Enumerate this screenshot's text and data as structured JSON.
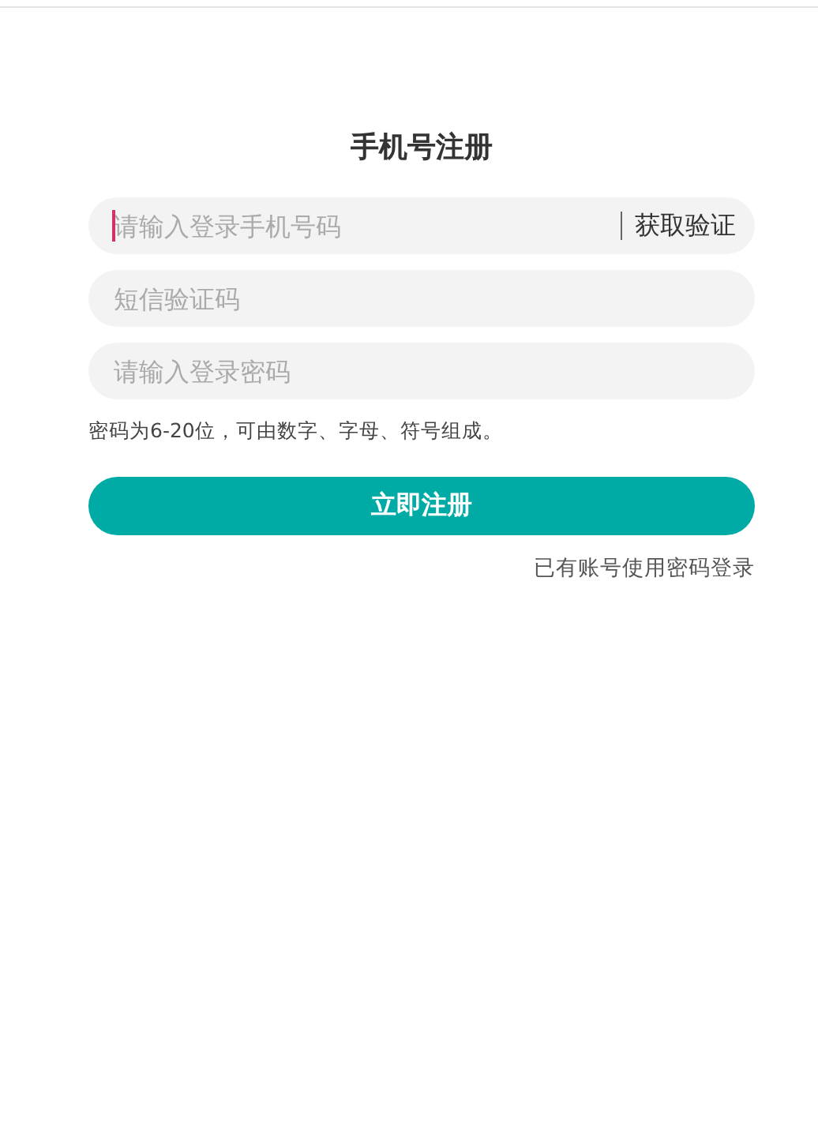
{
  "title": "手机号注册",
  "fields": [
    {
      "placeholder": "请输入登录手机号码",
      "focused": true,
      "action": "获取验证"
    },
    {
      "placeholder": "短信验证码",
      "focused": false
    },
    {
      "placeholder": "请输入登录密码",
      "focused": false
    }
  ],
  "hint": "密码为6-20位，可由数字、字母、符号组成。",
  "submit": "立即注册",
  "login_link": "已有账号使用密码登录"
}
